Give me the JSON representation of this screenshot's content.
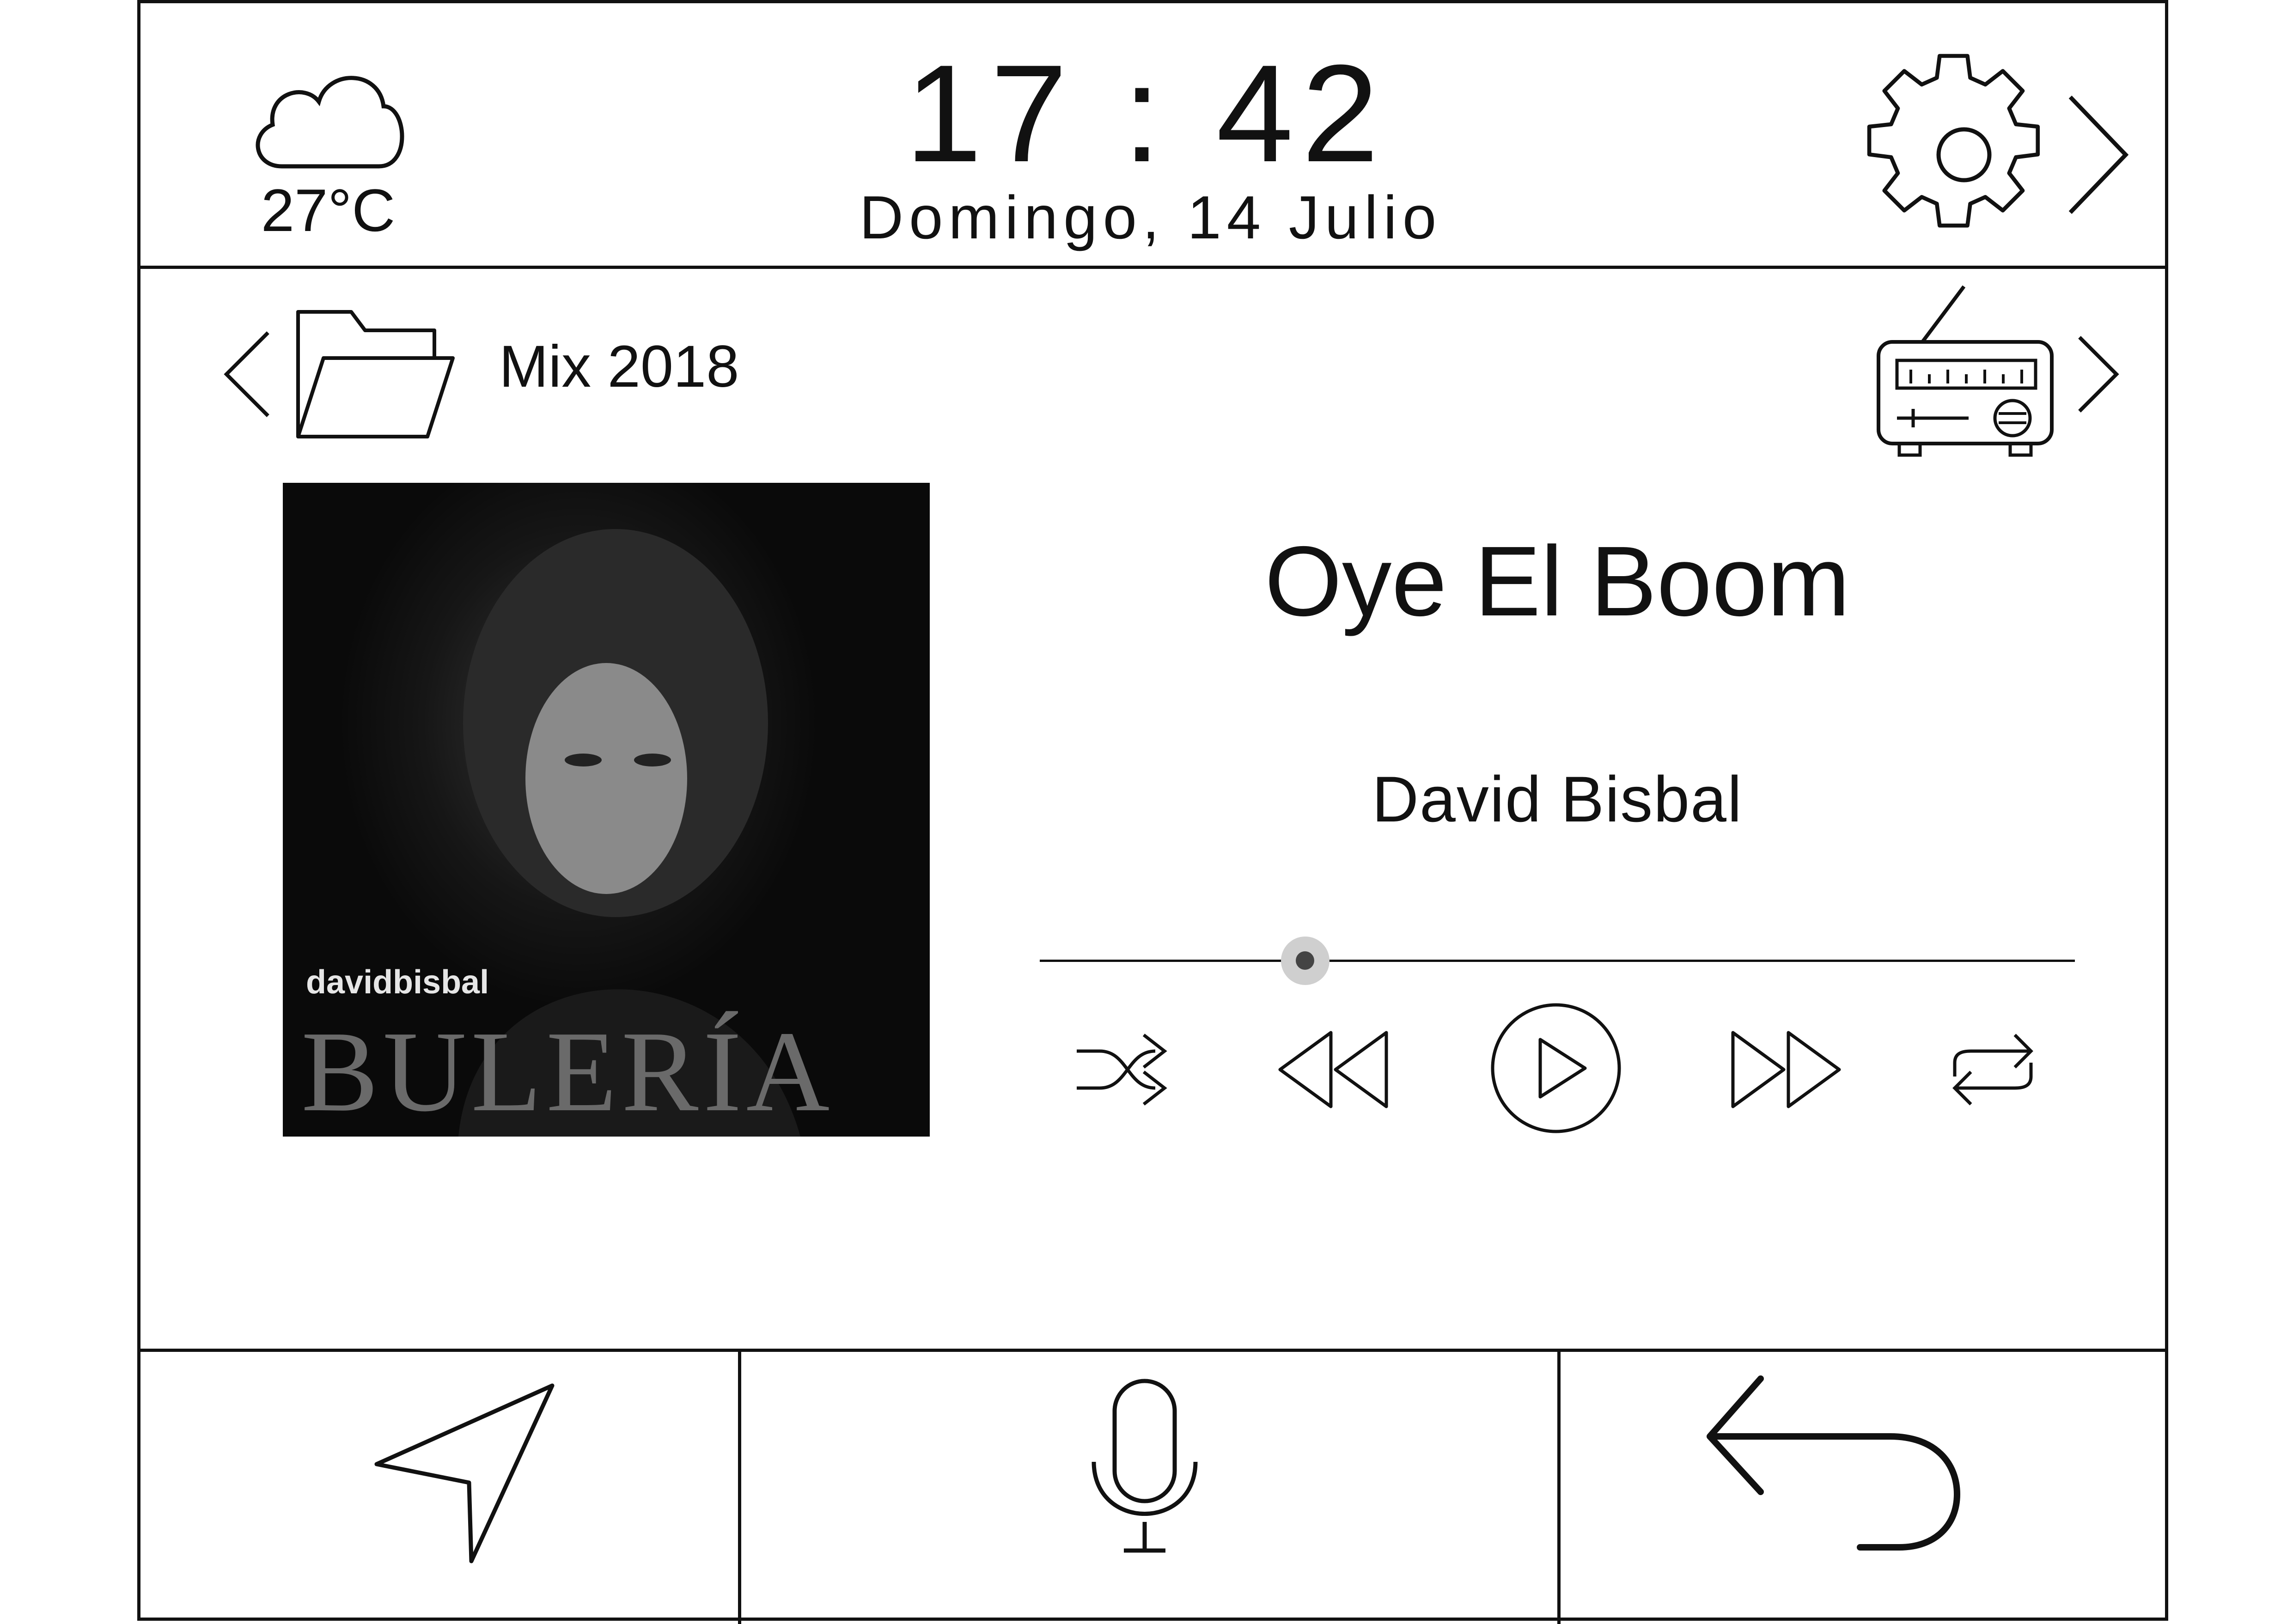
{
  "status_bar": {
    "weather": {
      "icon": "cloud-icon",
      "temperature": "27°C"
    },
    "clock": "17 : 42",
    "date": "Domingo, 14 Julio",
    "settings_icon": "gear-icon"
  },
  "media": {
    "source_folder": "Mix 2018",
    "radio_icon": "radio-icon",
    "album_art": {
      "artist_text": "davidbisbal",
      "title_text": "BULERÍA"
    },
    "track_title": "Oye El Boom",
    "artist": "David Bisbal",
    "progress": 0.26,
    "controls": [
      "shuffle-icon",
      "rewind-icon",
      "play-icon",
      "fast-forward-icon",
      "repeat-icon"
    ]
  },
  "bottom_nav": [
    "navigation-icon",
    "microphone-icon",
    "back-icon"
  ]
}
